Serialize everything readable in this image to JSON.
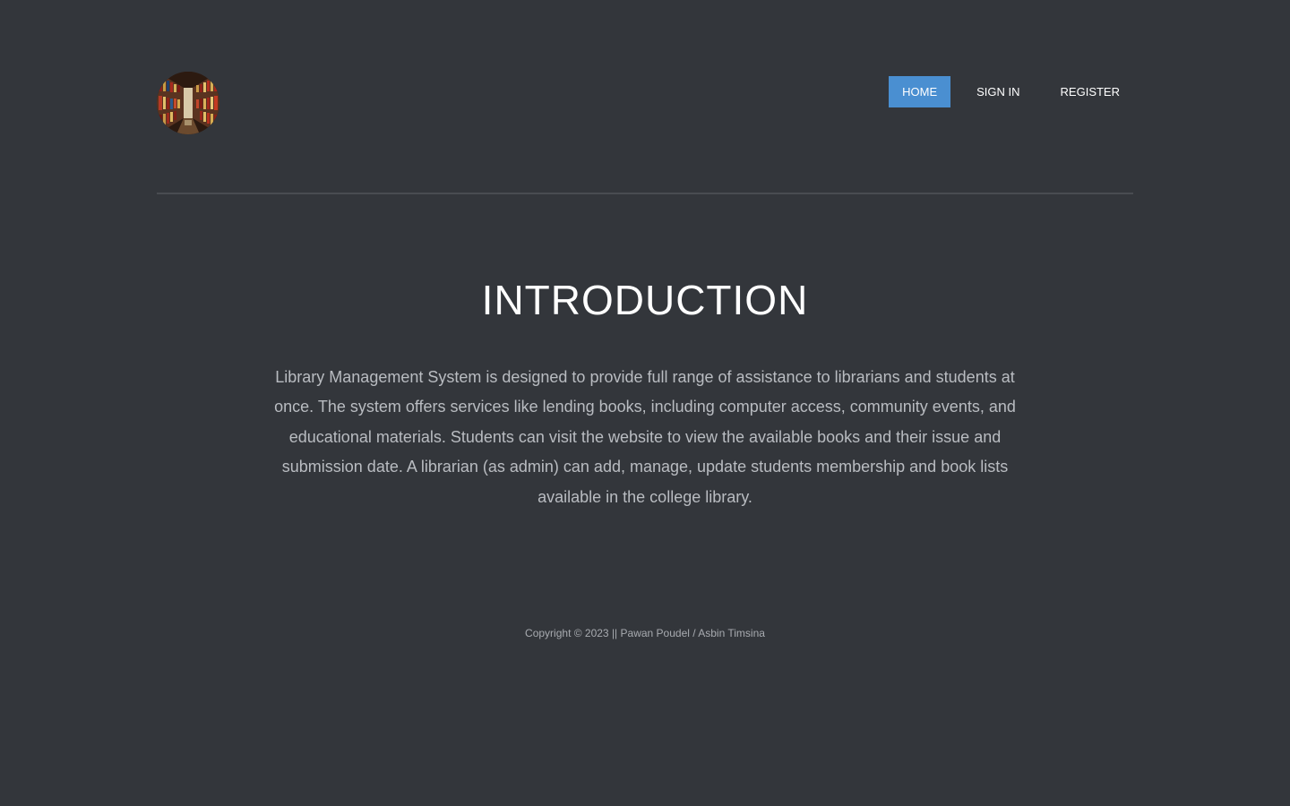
{
  "header": {
    "logo_icon": "library-bookshelf-image",
    "nav": [
      {
        "label": "HOME",
        "active": true
      },
      {
        "label": "SIGN IN",
        "active": false
      },
      {
        "label": "REGISTER",
        "active": false
      }
    ]
  },
  "main": {
    "title": "INTRODUCTION",
    "description": "Library Management System is designed to provide full range of assistance to librarians and students at once. The system offers services like lending books, including computer access, community events, and educational materials. Students can visit the website to view the available books and their issue and submission date. A librarian (as admin) can add, manage, update students membership and book lists available in the college library."
  },
  "footer": {
    "copyright": "Copyright © 2023 || Pawan Poudel / Asbin Timsina"
  },
  "colors": {
    "background": "#33363b",
    "accent": "#4a8fd1",
    "body_text": "#b9bcc1"
  }
}
